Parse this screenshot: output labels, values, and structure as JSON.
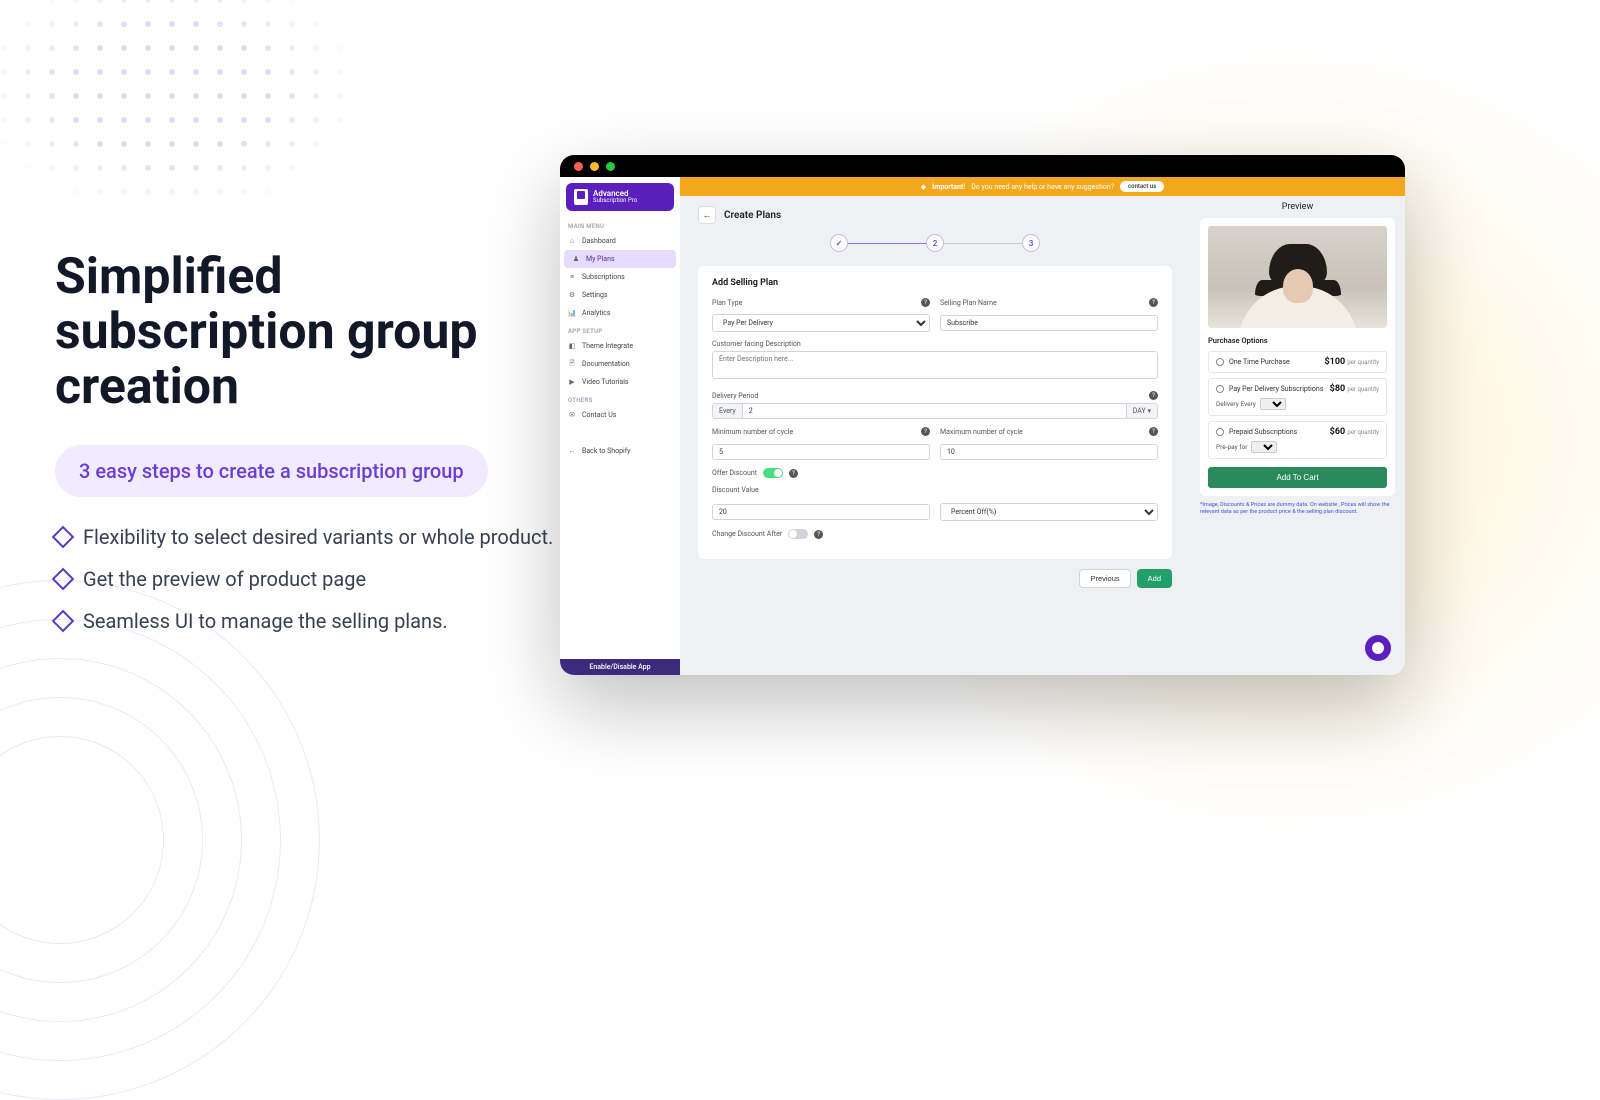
{
  "hero": {
    "title": "Simplified subscription group creation",
    "pill": "3 easy steps to create a subscription group",
    "bullets": [
      "Flexibility to select desired variants or whole product.",
      "Get the preview of product page",
      "Seamless UI to manage the selling plans."
    ]
  },
  "app": {
    "brand_line1": "Advanced",
    "brand_line2": "Subscription Pro",
    "menu": {
      "main_label": "MAIN MENU",
      "main": [
        "Dashboard",
        "My Plans",
        "Subscriptions",
        "Settings",
        "Analytics"
      ],
      "setup_label": "APP SETUP",
      "setup": [
        "Theme Integrate",
        "Documentation",
        "Video Tutorials"
      ],
      "others_label": "OTHERS",
      "others": [
        "Contact Us"
      ],
      "back": "Back to Shopify"
    },
    "footer": "Enable/Disable App",
    "alert_strong": "Important!",
    "alert_text": "Do you need any help or have any suggestion?",
    "alert_cta": "contact us",
    "page": {
      "title": "Create Plans",
      "step1": "✓",
      "step2": "2",
      "step3": "3"
    },
    "form": {
      "card_title": "Add Selling Plan",
      "plan_type_label": "Plan Type",
      "plan_type_value": "Pay Per Delivery",
      "plan_name_label": "Selling Plan Name",
      "plan_name_value": "Subscribe",
      "desc_label": "Customer facing Description",
      "desc_placeholder": "Enter Description here...",
      "delivery_label": "Delivery Period",
      "every": "Every",
      "delivery_value": "2",
      "delivery_unit": "DAY",
      "min_label": "Minimum number of cycle",
      "min_value": "5",
      "max_label": "Maximum number of cycle",
      "max_value": "10",
      "offer_label": "Offer Discount",
      "discount_label": "Discount Value",
      "discount_value": "20",
      "discount_type": "Percent Off(%)",
      "change_label": "Change Discount After",
      "prev_btn": "Previous",
      "add_btn": "Add"
    },
    "preview": {
      "title": "Preview",
      "po_label": "Purchase Options",
      "opts": [
        {
          "name": "One Time Purchase",
          "price": "$100",
          "unit": "per quantity"
        },
        {
          "name": "Pay Per Delivery Subscriptions",
          "price": "$80",
          "unit": "per quantity",
          "sub_label": "Delivery Every"
        },
        {
          "name": "Prepaid Subscriptions",
          "price": "$60",
          "unit": "per quantity",
          "sub_label": "Pre-pay for"
        }
      ],
      "add_to_cart": "Add To Cart",
      "disclaimer": "*Image, Discounts & Prices are dummy data. On website , Prices will show the relevant data as per the product price & the selling plan discount."
    }
  }
}
